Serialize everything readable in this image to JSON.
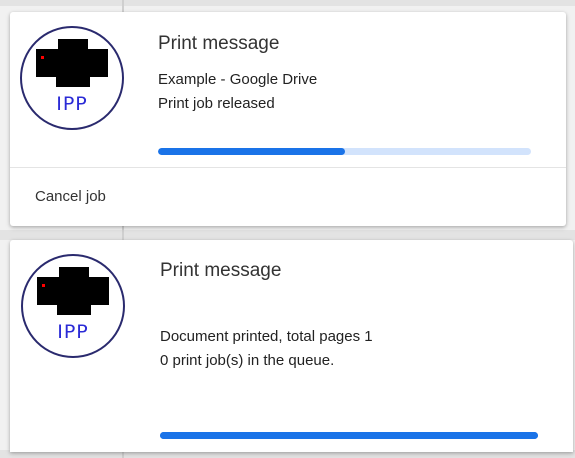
{
  "notifications": [
    {
      "title": "Print message",
      "logo_text": "IPP",
      "icon": "printer-icon",
      "line1": "Example - Google Drive",
      "line2": "Print job released",
      "progress": 0.5,
      "action_label": "Cancel job"
    },
    {
      "title": "Print message",
      "logo_text": "IPP",
      "icon": "printer-icon",
      "line1": "Document printed, total pages 1",
      "line2": "0 print job(s) in the queue.",
      "progress": 1.0
    }
  ],
  "colors": {
    "progress_fill": "#1a73e8",
    "progress_track": "#d2e3fc",
    "logo_text": "#2b2bd6",
    "logo_ring": "#2a2a6e",
    "printer_dot": "#ff0000"
  }
}
